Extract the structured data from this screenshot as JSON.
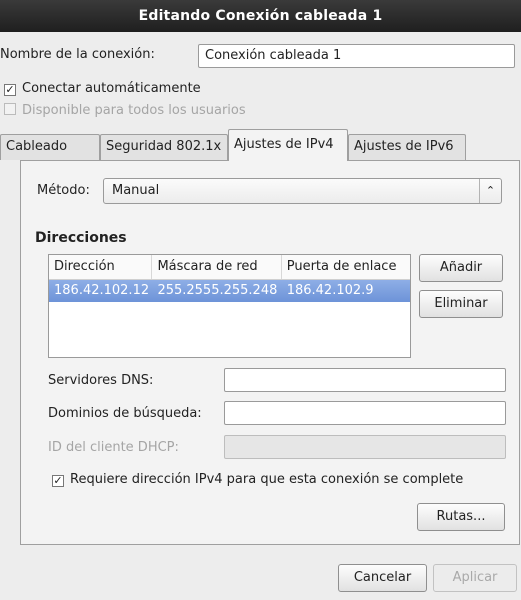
{
  "window": {
    "title": "Editando Conexión cableada 1"
  },
  "connection": {
    "name_label": "Nombre de la conexión:",
    "name_value": "Conexión cableada 1",
    "auto_connect_label": "Conectar automáticamente",
    "auto_connect_checked": true,
    "all_users_label": "Disponible para todos los usuarios",
    "all_users_checked": false
  },
  "tabs": [
    {
      "label": "Cableado",
      "active": false
    },
    {
      "label": "Seguridad 802.1x",
      "active": false
    },
    {
      "label": "Ajustes de IPv4",
      "active": true
    },
    {
      "label": "Ajustes de IPv6",
      "active": false
    }
  ],
  "ipv4": {
    "method_label": "Método:",
    "method_value": "Manual",
    "addresses_heading": "Direcciones",
    "columns": [
      "Dirección",
      "Máscara de red",
      "Puerta de enlace"
    ],
    "rows": [
      {
        "address": "186.42.102.12",
        "netmask": "255.2555.255.248",
        "gateway": "186.42.102.9",
        "selected": true
      }
    ],
    "add_button": "Añadir",
    "delete_button": "Eliminar",
    "dns_label": "Servidores DNS:",
    "dns_value": "",
    "search_domains_label": "Dominios de búsqueda:",
    "search_domains_value": "",
    "dhcp_client_id_label": "ID del cliente DHCP:",
    "dhcp_client_id_value": "",
    "require_ipv4_label": "Requiere dirección IPv4 para que esta conexión se complete",
    "require_ipv4_checked": true,
    "routes_button": "Rutas..."
  },
  "footer": {
    "cancel_button": "Cancelar",
    "apply_button": "Aplicar"
  }
}
